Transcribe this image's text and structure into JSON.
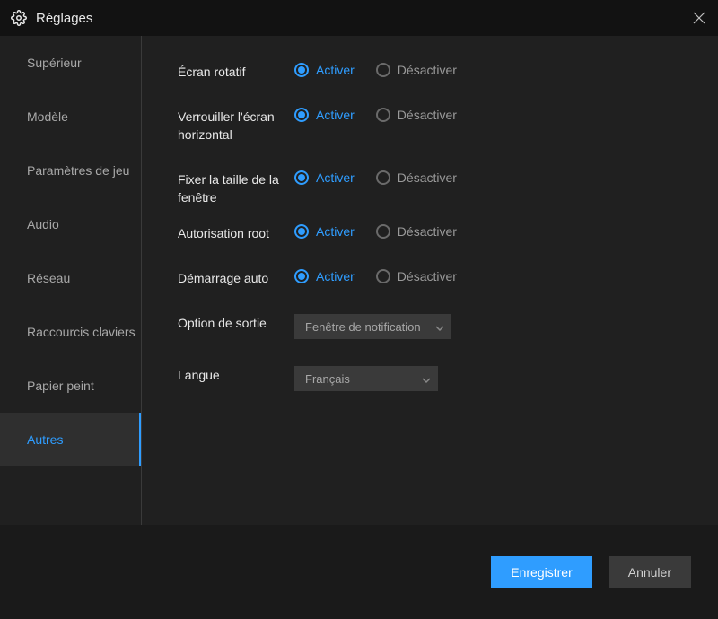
{
  "header": {
    "title": "Réglages"
  },
  "sidebar": {
    "items": [
      {
        "label": "Supérieur"
      },
      {
        "label": "Modèle"
      },
      {
        "label": "Paramètres de jeu"
      },
      {
        "label": "Audio"
      },
      {
        "label": "Réseau"
      },
      {
        "label": "Raccourcis claviers"
      },
      {
        "label": "Papier peint"
      },
      {
        "label": "Autres"
      }
    ],
    "activeIndex": 7
  },
  "settings": {
    "rotating_screen": {
      "label": "Écran rotatif",
      "options": {
        "on": "Activer",
        "off": "Désactiver"
      },
      "value": "on"
    },
    "lock_horizontal": {
      "label": "Verrouiller l'écran horizontal",
      "options": {
        "on": "Activer",
        "off": "Désactiver"
      },
      "value": "on"
    },
    "fix_window_size": {
      "label": "Fixer la taille de la fenêtre",
      "options": {
        "on": "Activer",
        "off": "Désactiver"
      },
      "value": "on"
    },
    "root_auth": {
      "label": "Autorisation root",
      "options": {
        "on": "Activer",
        "off": "Désactiver"
      },
      "value": "on"
    },
    "auto_start": {
      "label": "Démarrage auto",
      "options": {
        "on": "Activer",
        "off": "Désactiver"
      },
      "value": "on"
    },
    "exit_option": {
      "label": "Option de sortie",
      "value": "Fenêtre de notification"
    },
    "language": {
      "label": "Langue",
      "value": "Français"
    }
  },
  "footer": {
    "save": "Enregistrer",
    "cancel": "Annuler"
  }
}
